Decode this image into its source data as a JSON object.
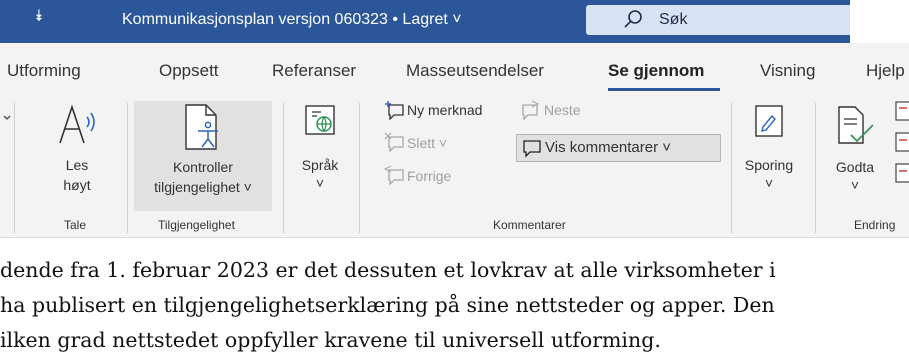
{
  "titlebar": {
    "qa_arrow": "⯯",
    "doc_title": "Kommunikasjonsplan versjon 060323 • Lagret ˅",
    "search_label": "Søk",
    "bg_color": "#2b579a"
  },
  "tabs": [
    {
      "label": "Utforming"
    },
    {
      "label": "Oppsett"
    },
    {
      "label": "Referanser"
    },
    {
      "label": "Masseutsendelser"
    },
    {
      "label": "Se gjennom",
      "active": true
    },
    {
      "label": "Visning"
    },
    {
      "label": "Hjelp"
    }
  ],
  "ribbon": {
    "les_hoyt": {
      "line1": "Les",
      "line2": "høyt"
    },
    "kontroller": {
      "line1": "Kontroller",
      "line2": "tilgjengelighet ˅"
    },
    "sprak": {
      "label": "Språk",
      "arrow": "˅"
    },
    "ny_merknad": "Ny merknad",
    "neste": "Neste",
    "slett": "Slett ˅",
    "forrige": "Forrige",
    "vis_kommentarer": "Vis kommentarer ˅",
    "sporing": {
      "label": "Sporing",
      "arrow": "˅"
    },
    "godta": {
      "label": "Godta",
      "arrow": "˅"
    },
    "groups": {
      "tale": "Tale",
      "tilgjengelighet": "Tilgjengelighet",
      "kommentarer": "Kommentarer",
      "endring": "Endring"
    }
  },
  "document": {
    "lines": [
      "dende fra 1. februar 2023 er det dessuten et lovkrav at alle virksomheter i",
      "ha publisert en tilgjengelighetserklæring på sine nettsteder og apper. Den",
      "ilken grad nettstedet oppfyller kravene til universell utforming."
    ]
  }
}
